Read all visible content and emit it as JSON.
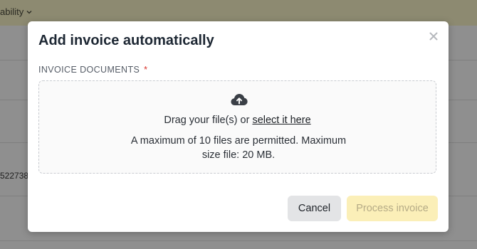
{
  "background": {
    "topbar_partial_text": "ability",
    "row_partial_text": "522738"
  },
  "modal": {
    "title": "Add invoice automatically",
    "close_icon": "close-icon",
    "field_label": "INVOICE DOCUMENTS",
    "required_marker": "*",
    "dropzone": {
      "icon": "cloud-upload-icon",
      "drag_text": "Drag your file(s) or ",
      "select_link": "select it here",
      "limits_line1": "A maximum of 10 files are permitted. Maximum",
      "limits_line2": "size file: 20 MB."
    },
    "buttons": {
      "cancel": "Cancel",
      "process": "Process invoice"
    }
  },
  "colors": {
    "accent_disabled": "#fbefb8",
    "required": "#d9332b"
  }
}
